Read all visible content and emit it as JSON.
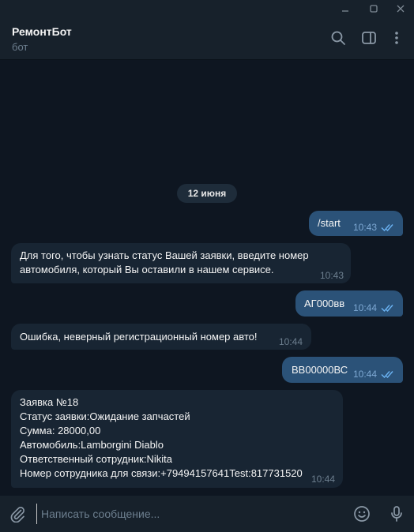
{
  "window": {
    "controls": [
      "minimize",
      "maximize",
      "close"
    ]
  },
  "header": {
    "title": "РемонтБот",
    "subtitle": "бот",
    "icons": [
      "search-icon",
      "sidebar-panel-icon",
      "more-vertical-icon"
    ]
  },
  "chat": {
    "date": "12 июня",
    "messages": [
      {
        "direction": "out",
        "text": "/start",
        "time": "10:43",
        "read": true
      },
      {
        "direction": "in",
        "text": "Для того, чтобы узнать статус Вашей заявки, введите номер\nавтомобиля, который Вы оставили в нашем сервисе.",
        "time": "10:43"
      },
      {
        "direction": "out",
        "text": "АГ000вв",
        "time": "10:44",
        "read": true
      },
      {
        "direction": "in",
        "text": "Ошибка, неверный регистрационный номер авто!",
        "time": "10:44"
      },
      {
        "direction": "out",
        "text": "ВВ00000ВС",
        "time": "10:44",
        "read": true
      },
      {
        "direction": "in",
        "text": "Заявка №18\nСтатус заявки:Ожидание запчастей\nСумма: 28000,00\nАвтомобиль:Lamborgini Diablo\nОтветственный сотрудник:Nikita\nНомер сотрудника для связи:+79494157641Test:817731520",
        "time": "10:44"
      }
    ]
  },
  "composer": {
    "placeholder": "Написать сообщение...",
    "value": "",
    "icons": [
      "paperclip-icon",
      "emoji-icon",
      "microphone-icon"
    ]
  },
  "colors": {
    "background": "#0e1621",
    "panel": "#17212b",
    "incoming_bubble": "#182533",
    "outgoing_bubble": "#2b5278",
    "read_ticks": "#6ab2f2"
  }
}
